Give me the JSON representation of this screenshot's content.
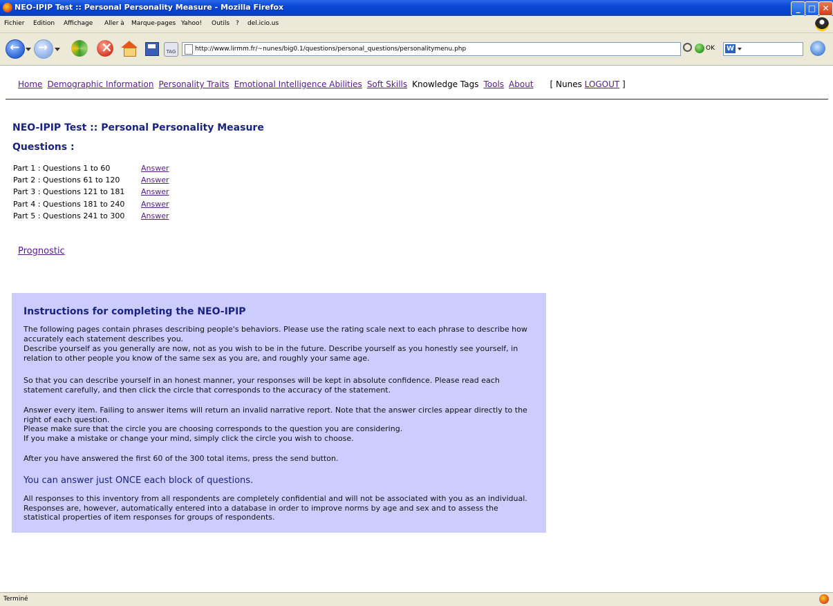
{
  "window": {
    "title": "NEO-IPIP Test :: Personal Personality Measure - Mozilla Firefox",
    "minimize_glyph": "_",
    "maximize_glyph": "□",
    "close_glyph": "✕"
  },
  "menubar": {
    "items": [
      "Fichier",
      "Edition",
      "Affichage",
      "Aller à",
      "Marque-pages",
      "Yahoo!",
      "Outils",
      "?",
      "del.icio.us"
    ]
  },
  "toolbar": {
    "url": "http://www.lirmm.fr/~nunes/big0.1/questions/personal_questions/personalitymenu.php",
    "ok_label": "OK",
    "tag_label": "TAG",
    "w_label": "W"
  },
  "nav": {
    "links": [
      "Home",
      "Demographic Information",
      "Personality Traits",
      "Emotional Intelligence Abilities",
      "Soft Skills"
    ],
    "current": "Knowledge Tags",
    "links2": [
      "Tools",
      "About"
    ],
    "user_prefix": "[ Nunes ",
    "logout": "LOGOUT",
    "user_suffix": " ]"
  },
  "page": {
    "title": "NEO-IPIP Test :: Personal Personality Measure",
    "questions_heading": "Questions :",
    "parts": [
      {
        "label": "Part 1 : Questions 1 to 60",
        "link": "Answer"
      },
      {
        "label": "Part 2 : Questions 61 to 120",
        "link": "Answer"
      },
      {
        "label": "Part 3 : Questions 121 to 181",
        "link": "Answer"
      },
      {
        "label": "Part 4 : Questions 181 to 240",
        "link": "Answer"
      },
      {
        "label": "Part 5 : Questions 241 to 300",
        "link": "Answer"
      }
    ],
    "prognostic": "Prognostic"
  },
  "instructions": {
    "heading": "Instructions for completing the NEO-IPIP",
    "p1": "The following pages contain phrases describing people's behaviors. Please use the rating scale next to each phrase to describe how accurately each statement describes you.",
    "p1b": "Describe yourself as you generally are now, not as you wish to be in the future. Describe yourself as you honestly see yourself, in relation to other people you know of the same sex as you are, and roughly your same age.",
    "p2": "So that you can describe yourself in an honest manner, your responses will be kept in absolute confidence. Please read each statement carefully, and then click the circle that corresponds to the accuracy of the statement.",
    "p3": "Answer every item. Failing to answer items will return an invalid narrative report. Note that the answer circles appear directly to the right of each question.",
    "p3b": "Please make sure that the circle you are choosing corresponds to the question you are considering.",
    "p3c": "If you make a mistake or change your mind, simply click the circle you wish to choose.",
    "p4": "After you have answered the first 60 of the 300 total items, press the send button.",
    "emphasis": "You can answer just ONCE each block of questions.",
    "p5": "All responses to this inventory from all respondents are completely confidential and will not be associated with you as an individual. Responses are, however, automatically entered into a database in order to improve norms by age and sex and to assess the statistical properties of item responses for groups of respondents."
  },
  "status": {
    "text": "Terminé"
  }
}
